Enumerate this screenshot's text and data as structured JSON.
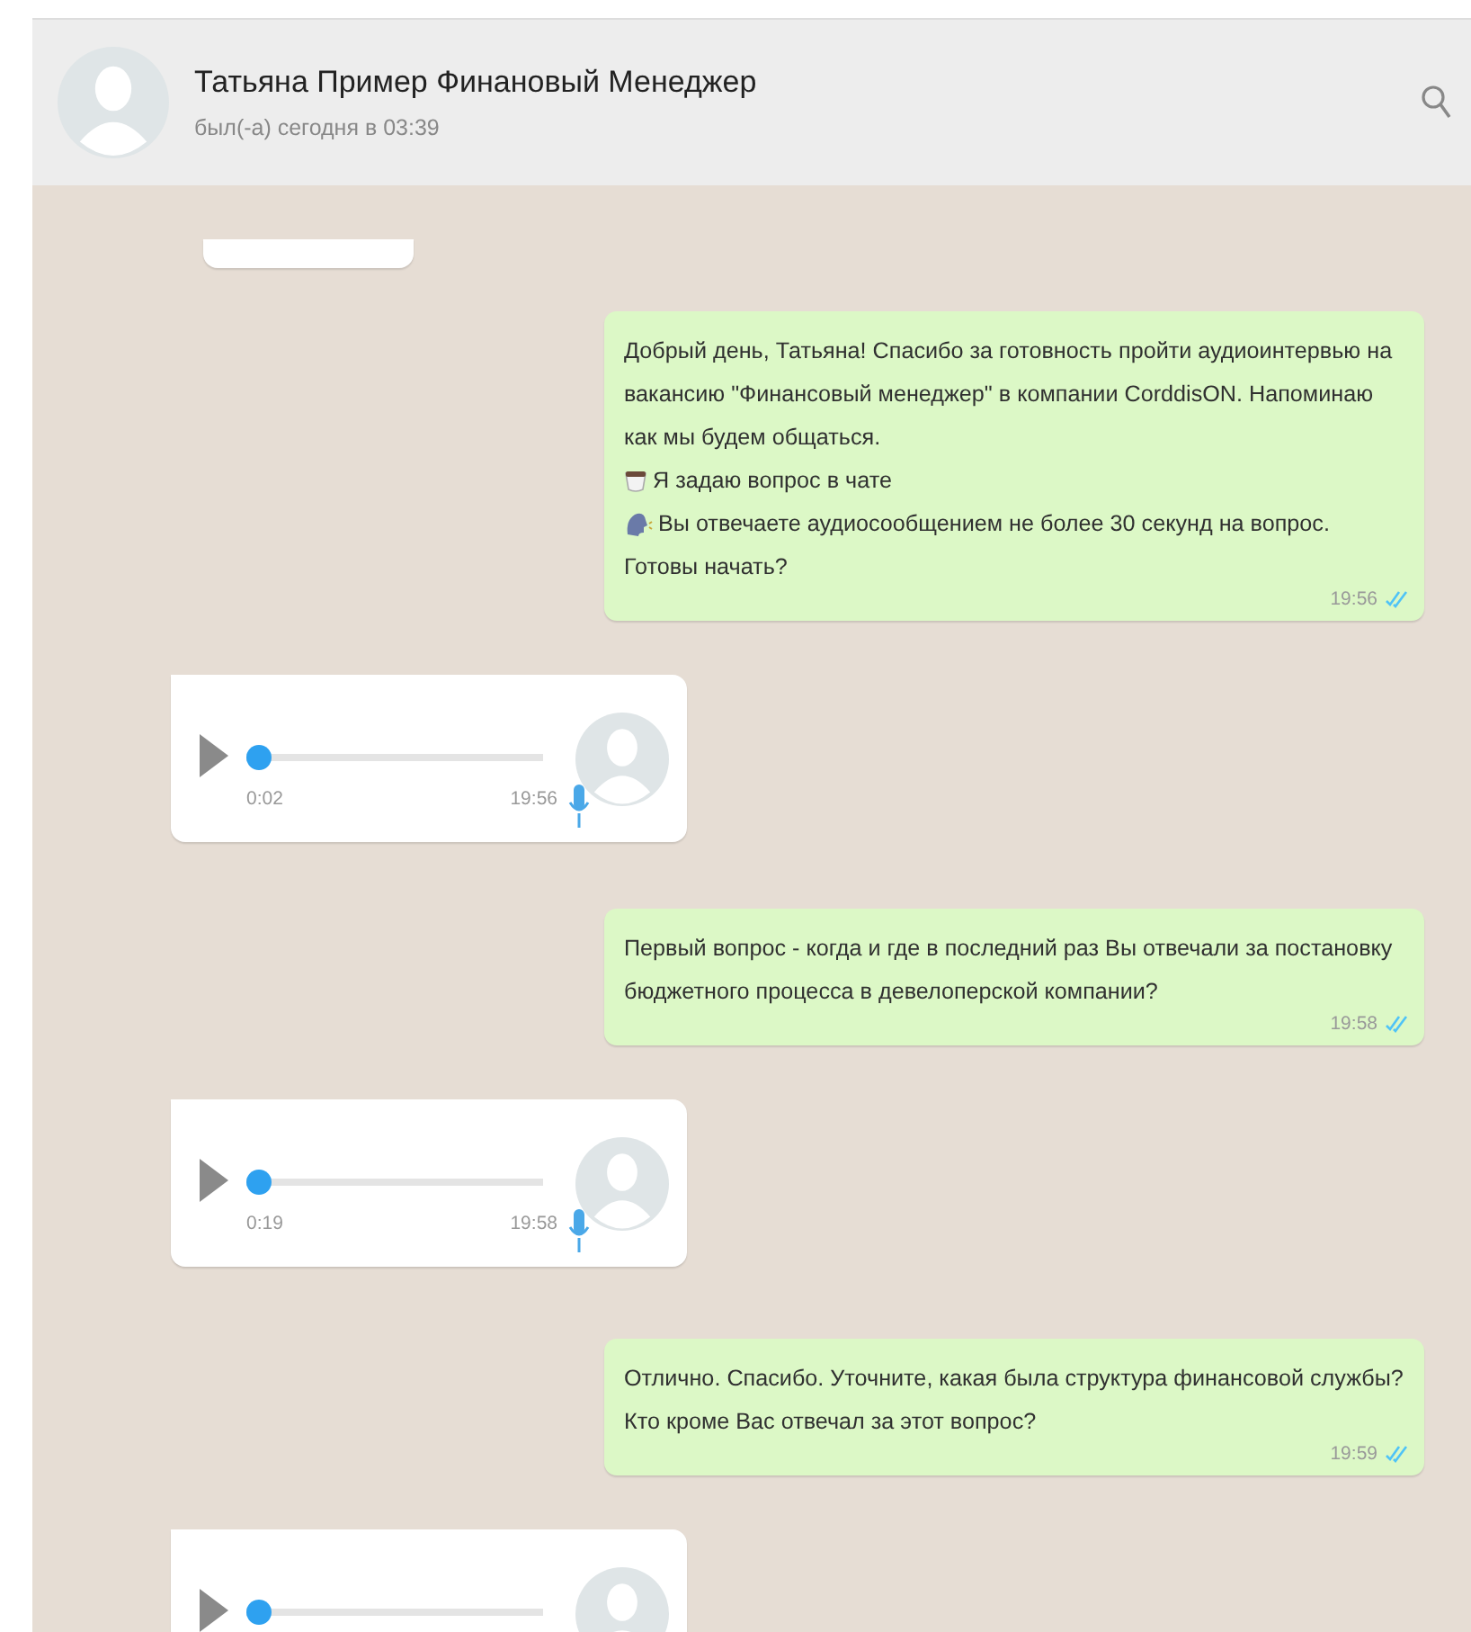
{
  "header": {
    "name": "Татьяна Пример Финановый Менеджер",
    "status": "был(-а) сегодня в 03:39"
  },
  "messages": [
    {
      "kind": "stub"
    },
    {
      "kind": "text",
      "lines": [
        {
          "text": "Добрый день, Татьяна! Спасибо за готовность пройти аудиоинтервью на вакансию \"Финансовый менеджер\" в компании CorddisON. Напоминаю как мы будем общаться."
        },
        {
          "kind": "cup",
          "text": "Я задаю вопрос в чате"
        },
        {
          "kind": "speaker",
          "text": "Вы отвечаете аудиосообщением не более 30 секунд на вопрос."
        },
        {
          "text": "Готовы начать?"
        }
      ],
      "time": "19:56",
      "read": true
    },
    {
      "kind": "voice",
      "duration": "0:02",
      "time": "19:56",
      "level": 0
    },
    {
      "kind": "text",
      "lines": [
        {
          "text": "Первый вопрос - когда и где в последний раз Вы отвечали за постановку бюджетного процесса в девелоперской компании?"
        }
      ],
      "time": "19:58",
      "read": true
    },
    {
      "kind": "voice",
      "duration": "0:19",
      "time": "19:58",
      "level": 0
    },
    {
      "kind": "text",
      "lines": [
        {
          "text": "Отлично. Спасибо. Уточните, какая была структура финансовой службы? Кто кроме Вас отвечал за этот вопрос?"
        }
      ],
      "time": "19:59",
      "read": true
    },
    {
      "kind": "voice",
      "level": 0
    }
  ]
}
